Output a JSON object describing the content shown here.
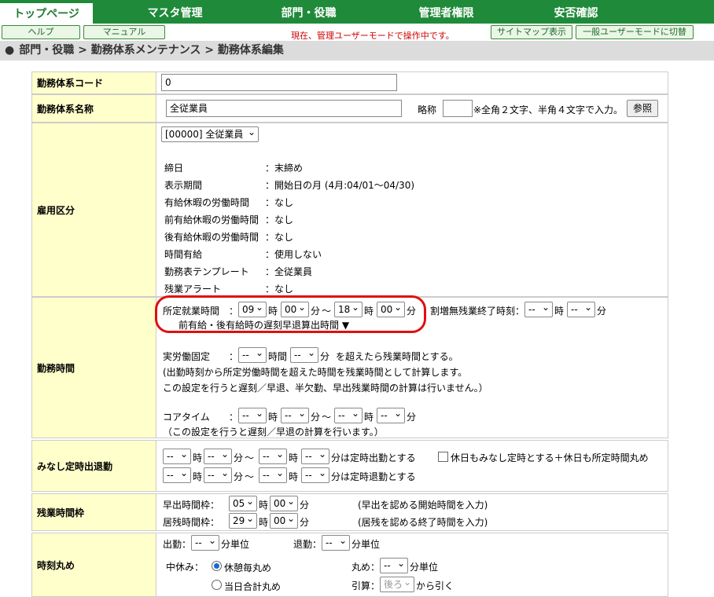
{
  "nav": {
    "tabs": [
      "トップページ",
      "マスタ管理",
      "部門・役職",
      "管理者権限",
      "安否確認"
    ]
  },
  "subbar": {
    "help": "ヘルプ",
    "manual": "マニュアル",
    "notice": "現在、管理ユーザーモードで操作中です。",
    "sitemap": "サイトマップ表示",
    "switch": "一般ユーザーモードに切替"
  },
  "breadcrumb": "部門・役職 > 勤務体系メンテナンス > 勤務体系編集",
  "form": {
    "code_label": "勤務体系コード",
    "code_value": "0",
    "name_label": "勤務体系名称",
    "name_value": "全従業員",
    "abbr_label": "略称",
    "abbr_note": "※全角２文字、半角４文字で入力。",
    "ref_button": "参照",
    "emp_label": "雇用区分",
    "emp_select": "[00000] 全従業員",
    "emp_info": [
      [
        "締日",
        "：末締め"
      ],
      [
        "表示期間",
        "：開始日の月 (4月:04/01〜04/30)"
      ],
      [
        "有給休暇の労働時間",
        "：なし"
      ],
      [
        "前有給休暇の労働時間",
        "：なし"
      ],
      [
        "後有給休暇の労働時間",
        "：なし"
      ],
      [
        "時間有給",
        "：使用しない"
      ],
      [
        "勤務表テンプレート",
        "：全従業員"
      ],
      [
        "残業アラート",
        "：なし"
      ]
    ],
    "work_label": "勤務時間",
    "work": {
      "fixed_label": "所定就業時間",
      "colon": "：",
      "start_h": "09",
      "start_m": "00",
      "end_h": "18",
      "end_m": "00",
      "ji": "時",
      "fun": "分",
      "tilde": "〜",
      "extra_label": "割増無残業終了時刻：",
      "dash": "--",
      "prev_note": "前有給・後有給時の遅刻早退算出時間 ▼",
      "actual_label": "実労働固定",
      "actual_note": "を超えたら残業時間とする。",
      "note1": "(出勤時刻から所定労働時間を超えた時間を残業時間として計算します。",
      "note2": "この設定を行うと遅刻／早退、半欠勤、早出残業時間の計算は行いません。）",
      "core_label": "コアタイム",
      "core_note": "（この設定を行うと遅刻／早退の計算を行います。）"
    },
    "minashi_label": "みなし定時出退勤",
    "minashi_in": "分は定時出勤とする",
    "minashi_out": "分は定時退勤とする",
    "minashi_check": "休日もみなし定時とする＋休日も所定時間丸め",
    "ot_label": "残業時間枠",
    "ot_early": "早出時間枠：",
    "ot_late": "居残時間枠：",
    "ot_early_h": "05",
    "ot_late_h": "29",
    "ot_m": "00",
    "ot_early_note": "(早出を認める開始時間を入力)",
    "ot_late_note": "(居残を認める終了時間を入力)",
    "round_label": "時刻丸め",
    "round_in": "出勤：",
    "round_out": "退勤：",
    "round_unit": "分単位",
    "break_label": "中休み：",
    "break_opt1": "休憩毎丸め",
    "break_opt2": "当日合計丸め",
    "round_label2": "丸め：",
    "pull_label": "引算：",
    "pull_sel": "後ろ",
    "pull_note": "から引く"
  }
}
